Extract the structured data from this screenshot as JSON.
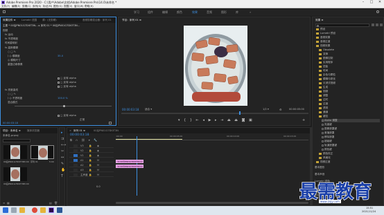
{
  "title_bar": {
    "title": "Adobe Premiere Pro 2020 - C:\\用户\\Adobe\\文档\\Adobe Premiere Pro\\14.0\\未命名 *",
    "minimize": "–",
    "maximize": "□",
    "close": "✕"
  },
  "menu": [
    "文件(F)",
    "编辑(E)",
    "剪辑(C)",
    "序列(S)",
    "标记(M)",
    "图形(G)",
    "视图(V)",
    "窗口(W)",
    "帮助(H)"
  ],
  "workspaces": {
    "items": [
      "学习",
      "组件",
      "编辑",
      "颜色",
      "效果",
      "音频",
      "图形",
      "库"
    ],
    "active_index": 4
  },
  "effect_controls": {
    "tabs": [
      "效果控件 ≡",
      "Lumetri 范围",
      "源：(无剪辑)",
      "音频剪辑混合器：序列 01"
    ],
    "header": "主要 * 00后PN01G7DI0T3N... ▸ 序列 01 * 00后PN01G7DI0T3N...",
    "rows": [
      {
        "label": "视频",
        "value": ""
      },
      {
        "label": "fx 运动",
        "value": ""
      },
      {
        "label": "fx 不透明度",
        "value": ""
      },
      {
        "label": "时间重映射",
        "value": ""
      },
      {
        "label": "fx 高斯模糊",
        "value": ""
      },
      {
        "label": "○ □ ✎",
        "value": ""
      },
      {
        "label": "⟩ ◎ 模糊度",
        "value": "35.0"
      },
      {
        "label": "◎ 模糊尺寸",
        "value": ""
      },
      {
        "label": "重复边缘像素",
        "value": ""
      },
      {
        "label": "fx 亮度曲线",
        "value": ""
      },
      {
        "label": "○ □ ✎",
        "value": ""
      },
      {
        "label": "⟩ ◎ 不透明度",
        "value": "100.0 %"
      },
      {
        "label": "混合模式",
        "value": "正常"
      }
    ],
    "checks": [
      "□ 反转 alpha",
      "□ 反转 alpha",
      "□ 反转 alpha",
      "□ 反转 alpha"
    ],
    "time_readout": "00:00:03:18",
    "slider_values": [
      "-100",
      "0",
      "100"
    ]
  },
  "program_monitor": {
    "title": "节目：序列 01 ≡",
    "timecode": "00:00:03:18",
    "fit": "适合",
    "fraction": "1/2",
    "duration": "00:00:05:00"
  },
  "effects_panel": {
    "title": "效果 ≡",
    "search_placeholder": "",
    "items": [
      {
        "label": "预设",
        "kind": "folder"
      },
      {
        "label": "Lumetri 预设",
        "kind": "folder"
      },
      {
        "label": "音频效果",
        "kind": "folder"
      },
      {
        "label": "音频过渡",
        "kind": "folder"
      },
      {
        "label": "视频效果",
        "kind": "folder"
      },
      {
        "label": "Obsolete",
        "kind": "folder"
      },
      {
        "label": "变换",
        "kind": "folder"
      },
      {
        "label": "图像控制",
        "kind": "folder"
      },
      {
        "label": "实用程序",
        "kind": "folder"
      },
      {
        "label": "扭曲",
        "kind": "folder"
      },
      {
        "label": "时间",
        "kind": "folder"
      },
      {
        "label": "杂色与颗粒",
        "kind": "folder"
      },
      {
        "label": "模糊与锐化",
        "kind": "folder"
      },
      {
        "label": "沉浸式视频",
        "kind": "folder"
      },
      {
        "label": "生成",
        "kind": "folder"
      },
      {
        "label": "视频",
        "kind": "folder"
      },
      {
        "label": "调整",
        "kind": "folder"
      },
      {
        "label": "过时",
        "kind": "folder"
      },
      {
        "label": "过渡",
        "kind": "folder"
      },
      {
        "label": "透视",
        "kind": "folder"
      },
      {
        "label": "通道",
        "kind": "folder"
      },
      {
        "label": "键控",
        "kind": "folder"
      },
      {
        "label": "Alpha 调整",
        "kind": "item"
      },
      {
        "label": "亮度键",
        "kind": "item"
      },
      {
        "label": "图像遮罩键",
        "kind": "item"
      },
      {
        "label": "差值遮罩",
        "kind": "item"
      },
      {
        "label": "移除遮罩",
        "kind": "item"
      },
      {
        "label": "超级键",
        "kind": "item"
      },
      {
        "label": "轨道遮罩键",
        "kind": "item"
      },
      {
        "label": "颜色键",
        "kind": "item"
      },
      {
        "label": "颜色校正",
        "kind": "folder"
      },
      {
        "label": "风格化",
        "kind": "folder"
      },
      {
        "label": "视频过渡",
        "kind": "folder"
      }
    ],
    "subpanels": [
      "基本图形",
      "基本声音",
      "Lumetri 颜色",
      "库",
      "标记"
    ]
  },
  "project_panel": {
    "tabs": [
      "项目：未命名 ≡",
      "媒体浏览器"
    ],
    "project_name": "未命名.prproj",
    "item_count": "",
    "items": [
      {
        "name": "00后PN01G7DI0T3N",
        "duration": "5:00"
      },
      {
        "name": "序列 01",
        "duration": "5:00"
      },
      {
        "name": "00后PN01G7DI0T3N",
        "duration": "5:00"
      }
    ]
  },
  "timeline": {
    "tab": "序列 01 ≡",
    "tab2": "00后PN01G7DI0T3N",
    "timecode": "00:00:03:18",
    "ruler": [
      ":00:00",
      "00:00:05:00",
      "00:00:10:00",
      "00:00:15:00"
    ],
    "tracks": [
      "V3",
      "V2",
      "V1",
      "A1",
      "A2",
      "A3",
      "主声道"
    ],
    "clips": [
      {
        "label": "fx 00后PN01G7DI0T3N.jpg",
        "track": 1
      },
      {
        "label": "fx 00后PN01G7DI0T3N.jpg",
        "track": 2
      }
    ],
    "master_value": "0.0"
  },
  "taskbar": {
    "time": "15:51",
    "date": "2021/11/24"
  },
  "watermark": {
    "text": "最需教育",
    "url": "www.zxjy.com"
  }
}
